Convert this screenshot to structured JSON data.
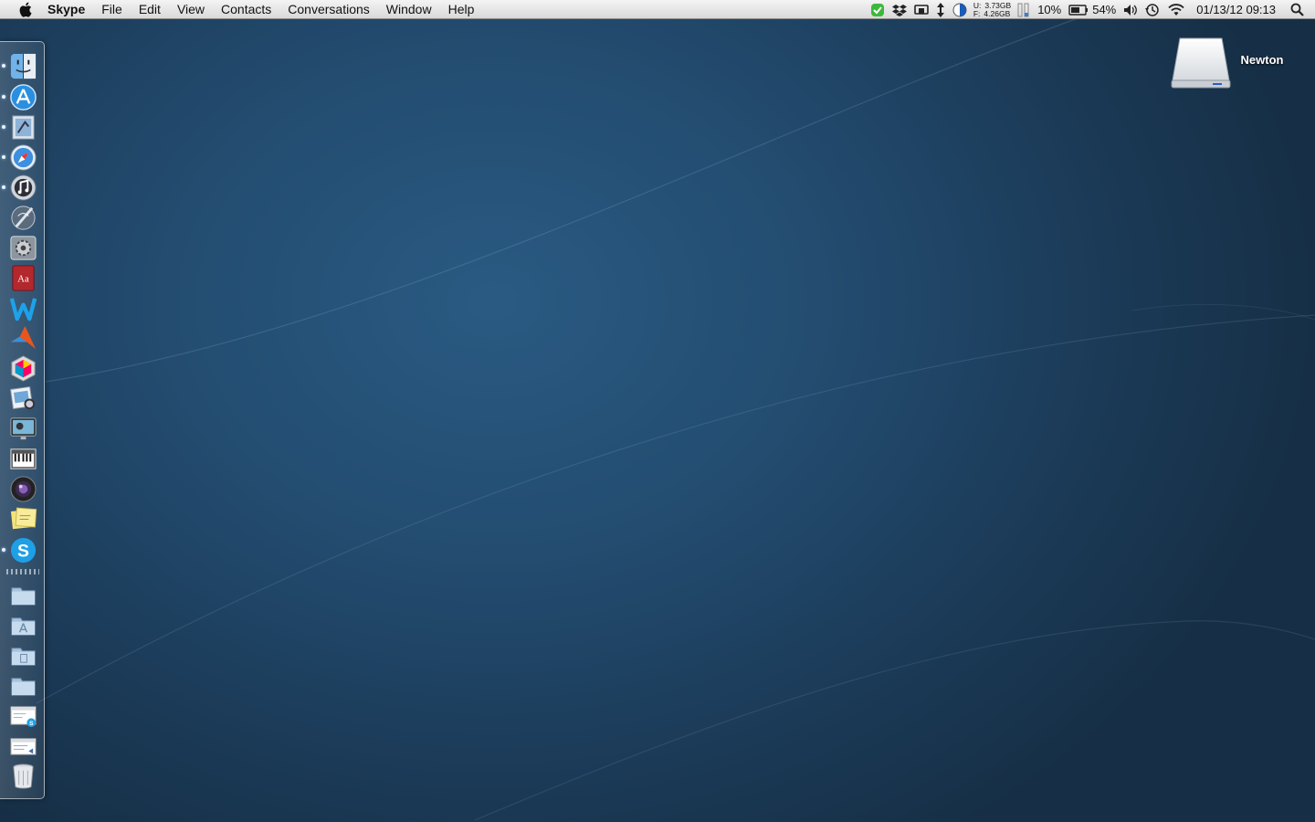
{
  "menubar": {
    "apple_icon": "apple-logo",
    "app_name": "Skype",
    "menus": [
      "File",
      "Edit",
      "View",
      "Contacts",
      "Conversations",
      "Window",
      "Help"
    ],
    "status": {
      "memory_used_label": "U:",
      "memory_used": "3.73GB",
      "memory_free_label": "F:",
      "memory_free": "4.26GB",
      "cpu": "10%",
      "battery": "54%",
      "datetime": "01/13/12 09:13"
    }
  },
  "desktop": {
    "drive_label": "Newton"
  },
  "dock": {
    "apps": [
      {
        "name": "finder",
        "running": true
      },
      {
        "name": "app-store",
        "running": true
      },
      {
        "name": "mail",
        "running": true
      },
      {
        "name": "safari",
        "running": true
      },
      {
        "name": "itunes",
        "running": true
      },
      {
        "name": "xcode-instruments",
        "running": false
      },
      {
        "name": "system-preferences",
        "running": false
      },
      {
        "name": "dictionary",
        "running": false
      },
      {
        "name": "writer",
        "running": false
      },
      {
        "name": "matlab",
        "running": false
      },
      {
        "name": "colorsync",
        "running": false
      },
      {
        "name": "preview",
        "running": false
      },
      {
        "name": "photo-booth",
        "running": false
      },
      {
        "name": "piano",
        "running": false
      },
      {
        "name": "aperture",
        "running": false
      },
      {
        "name": "stickies",
        "running": false
      },
      {
        "name": "skype",
        "running": true
      }
    ],
    "stacks": [
      "home-folder",
      "applications-folder",
      "documents-folder",
      "downloads-folder",
      "skype-window",
      "mail-window",
      "trash"
    ]
  },
  "colors": {
    "menubar_top": "#f4f4f4",
    "menubar_bottom": "#d9d9d9",
    "desktop": "#234c70",
    "skype_blue": "#1ea0e6"
  }
}
